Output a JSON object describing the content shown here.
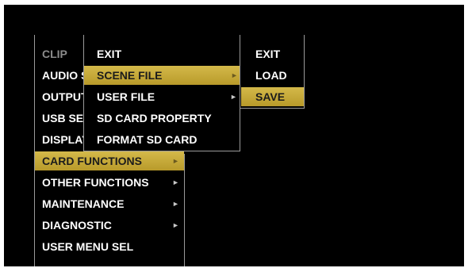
{
  "main_menu": {
    "items": [
      {
        "label": "CLIP",
        "dim": true
      },
      {
        "label": "AUDIO SETTINGS"
      },
      {
        "label": "OUTPUT SETTINGS"
      },
      {
        "label": "USB SETTINGS"
      },
      {
        "label": "DISPLAY SETTINGS"
      },
      {
        "label": "CARD FUNCTIONS",
        "selected": true
      },
      {
        "label": "OTHER FUNCTIONS"
      },
      {
        "label": "MAINTENANCE"
      },
      {
        "label": "DIAGNOSTIC"
      },
      {
        "label": "USER MENU SEL"
      }
    ],
    "arrow_glyph": "►"
  },
  "card_functions_menu": {
    "items": [
      {
        "label": "EXIT"
      },
      {
        "label": "SCENE FILE",
        "selected": true
      },
      {
        "label": "USER FILE"
      },
      {
        "label": "SD CARD PROPERTY"
      },
      {
        "label": "FORMAT SD CARD"
      }
    ]
  },
  "scene_file_menu": {
    "items": [
      {
        "label": "EXIT"
      },
      {
        "label": "LOAD"
      },
      {
        "label": "SAVE",
        "selected": true
      }
    ]
  },
  "colors": {
    "background": "#000000",
    "highlight": "#c9ad3c",
    "text": "#ffffff",
    "dim_text": "#8c8c8c",
    "border": "#9a9a9a"
  }
}
